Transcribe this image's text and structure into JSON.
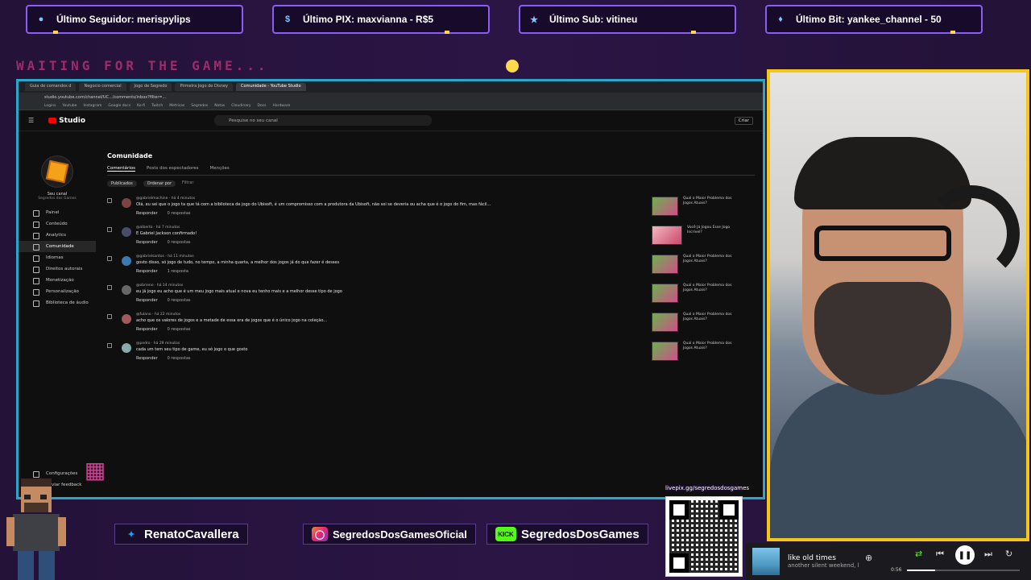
{
  "alerts": [
    {
      "icon": "person-icon",
      "label": "Último Seguidor: merispylips"
    },
    {
      "icon": "dollar-icon",
      "label": "Último PIX: maxvianna - R$5"
    },
    {
      "icon": "star-icon",
      "label": "Último Sub: vitineu"
    },
    {
      "icon": "diamond-icon",
      "label": "Último Bit: yankee_channel - 50"
    }
  ],
  "waiting_text": "WAITING FOR THE GAME...",
  "browser": {
    "tabs": [
      "Guia de comandos d",
      "Negocio comercial",
      "Jogo de Segredo",
      "Pirmeira Jogo de Disney",
      "Comunidade - YouTube Studio"
    ],
    "active_tab": 4,
    "url": "studio.youtube.com/channel/UC.../comments/inbox?filter=...",
    "bookmarks": [
      "Logins",
      "Youtube",
      "Instagram",
      "Google docs",
      "Ko-fi",
      "Twitch",
      "Metricas",
      "Segredos",
      "Notas",
      "Cloudinary",
      "Docs",
      "Hardware"
    ]
  },
  "studio": {
    "logo": "Studio",
    "search_placeholder": "Pesquise no seu canal",
    "create": "Criar",
    "channel_name": "Seu canal",
    "channel_sub": "Segredos dos Games",
    "nav": [
      {
        "label": "Painel",
        "active": false
      },
      {
        "label": "Conteúdo",
        "active": false
      },
      {
        "label": "Analytics",
        "active": false
      },
      {
        "label": "Comunidade",
        "active": true
      },
      {
        "label": "Idiomas",
        "active": false
      },
      {
        "label": "Direitos autorais",
        "active": false
      },
      {
        "label": "Monetização",
        "active": false
      },
      {
        "label": "Personalização",
        "active": false
      },
      {
        "label": "Biblioteca de áudio",
        "active": false
      }
    ],
    "settings": "Configurações",
    "feedback": "Enviar feedback",
    "page_title": "Comunidade",
    "subtabs": [
      "Comentários",
      "Posts dos espectadores",
      "Menções"
    ],
    "filters": {
      "published": "Publicados",
      "sort": "Ordenar por",
      "filter": "Filtrar"
    },
    "reply_label": "Responder",
    "comments": [
      {
        "author": "@gabrielmachine · há 4 minutos",
        "text": "Olá, eu sei que o jogo ta que tá com a biblioteca de jogo do Ubisoft, é um compromisso com a produtora da Ubisoft, não sei se deveria ou acha que é o jogo do fim, mas fácil...",
        "replies": "0 respostas",
        "video": "Qual o Maior Problema dos Jogos Atuais?"
      },
      {
        "author": "@alberto · há 7 minutos",
        "text": "E Gabriel Jackson confirmado!",
        "replies": "0 respostas",
        "video": "Você Já Jogou Esse Jogo Incrível?"
      },
      {
        "author": "@gabrielsantos · há 11 minutos",
        "text": "gosto disso, só jogo de tudo, no tempo, a minha quarta, a melhor dos jogos já do que fazer é desses",
        "replies": "1 resposta",
        "video": "Qual o Maior Problema dos Jogos Atuais?"
      },
      {
        "author": "@obrieno · há 14 minutos",
        "text": "eu já jogo eu acho que é um meu jogo mais atual e nova eu tenho mais e a melhor desse tipo de jogo",
        "replies": "0 respostas",
        "video": "Qual o Maior Problema dos Jogos Atuais?"
      },
      {
        "author": "@fulano · há 22 minutos",
        "text": "acho que os valores de jogos e a metade de essa era de jogos que é o único jogo na coleção...",
        "replies": "0 respostas",
        "video": "Qual o Maior Problema dos Jogos Atuais?"
      },
      {
        "author": "@pedro · há 29 minutos",
        "text": "cada um tem seu tipo de game, eu só jogo o que gosto",
        "replies": "0 respostas",
        "video": "Qual o Maior Problema dos Jogos Atuais?"
      }
    ]
  },
  "socials": [
    {
      "icon": "twitter-icon",
      "label": "RenatoCavallera"
    },
    {
      "icon": "instagram-icon",
      "label": "SegredosDosGamesOficial"
    },
    {
      "icon": "kick-icon",
      "label": "SegredosDosGames"
    }
  ],
  "qr_url": "livepix.gg/segredosdosgames",
  "music": {
    "title": "like old times",
    "artist": "another silent weekend, l",
    "time": "0:56",
    "progress": 0.25
  },
  "colors": {
    "accent": "#2aa6c9",
    "frame": "#f5c518",
    "brand": "#8b5cf6"
  }
}
